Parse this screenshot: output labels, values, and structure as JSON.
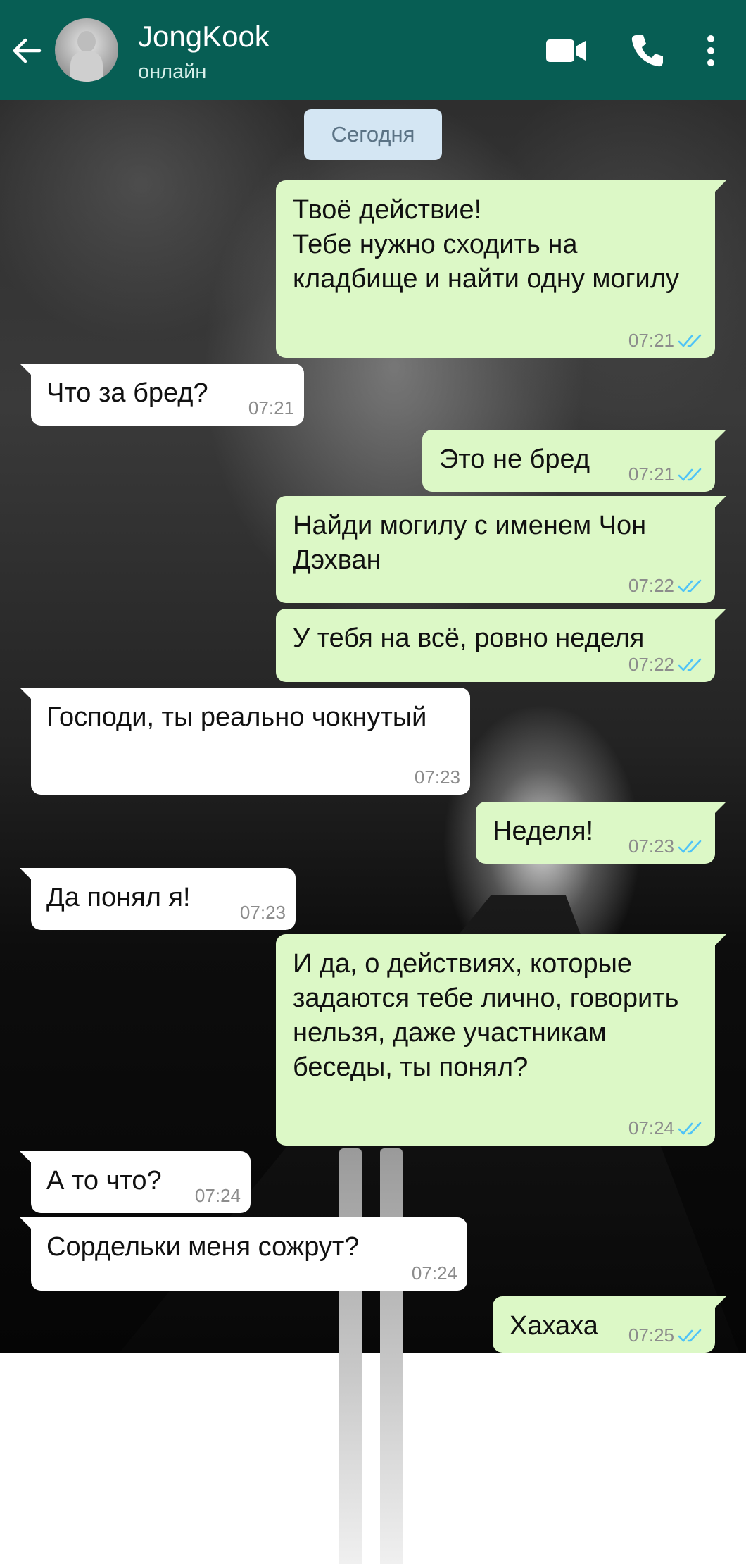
{
  "header": {
    "contact_name": "JongKook",
    "status": "онлайн",
    "bg_color": "#075e54",
    "icons": [
      "back-arrow-icon",
      "avatar",
      "video-call-icon",
      "phone-icon",
      "more-vert-icon"
    ]
  },
  "chat": {
    "date_chip": "Сегодня",
    "messages": [
      {
        "dir": "out",
        "text": "Твоё действие!\nТебе нужно сходить на кладбище и найти одну могилу",
        "time": "07:21",
        "read": true
      },
      {
        "dir": "in",
        "text": "Что за бред?",
        "time": "07:21"
      },
      {
        "dir": "out",
        "text": "Это не бред",
        "time": "07:21",
        "read": true
      },
      {
        "dir": "out",
        "text": "Найди могилу с именем Чон Дэхван",
        "time": "07:22",
        "read": true
      },
      {
        "dir": "out",
        "text": "У тебя на всё, ровно неделя",
        "time": "07:22",
        "read": true
      },
      {
        "dir": "in",
        "text": "Господи, ты реально чокнутый",
        "time": "07:23"
      },
      {
        "dir": "out",
        "text": "Неделя!",
        "time": "07:23",
        "read": true
      },
      {
        "dir": "in",
        "text": "Да понял я!",
        "time": "07:23"
      },
      {
        "dir": "out",
        "text": "И да, о действиях, которые задаются тебе лично, говорить нельзя, даже участникам беседы, ты понял?",
        "time": "07:24",
        "read": true
      },
      {
        "dir": "in",
        "text": "А то что?",
        "time": "07:24"
      },
      {
        "dir": "in",
        "text": "Сордельки меня сожрут?",
        "time": "07:24"
      },
      {
        "dir": "out",
        "text": "Хахаха",
        "time": "07:25",
        "read": true
      }
    ]
  },
  "colors": {
    "outgoing_bubble": "#dcf8c6",
    "incoming_bubble": "#ffffff",
    "read_tick": "#4fc3f7",
    "date_chip": "#d4e6f3"
  }
}
